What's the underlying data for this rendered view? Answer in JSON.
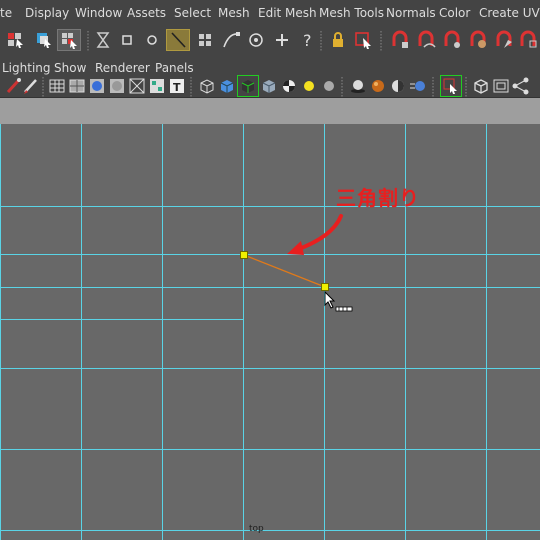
{
  "menubar": {
    "items": [
      "te",
      "Display",
      "Window",
      "Assets",
      "Select",
      "Mesh",
      "Edit Mesh",
      "Mesh Tools",
      "Normals",
      "Color",
      "Create UVs"
    ]
  },
  "panel_menu": {
    "items": [
      "Lighting",
      "Show",
      "Renderer",
      "Panels"
    ]
  },
  "viewport": {
    "camera_label": "top",
    "annotation": "三角割り",
    "colors": {
      "background": "#686868",
      "grid": "#5ad4e6",
      "edge": "#e07a1a",
      "vertex": "#f0f000",
      "annotation": "#e81f1f"
    }
  },
  "colors": {
    "menubar_bg": "#444444",
    "strip_bg": "#9e9e9e"
  }
}
